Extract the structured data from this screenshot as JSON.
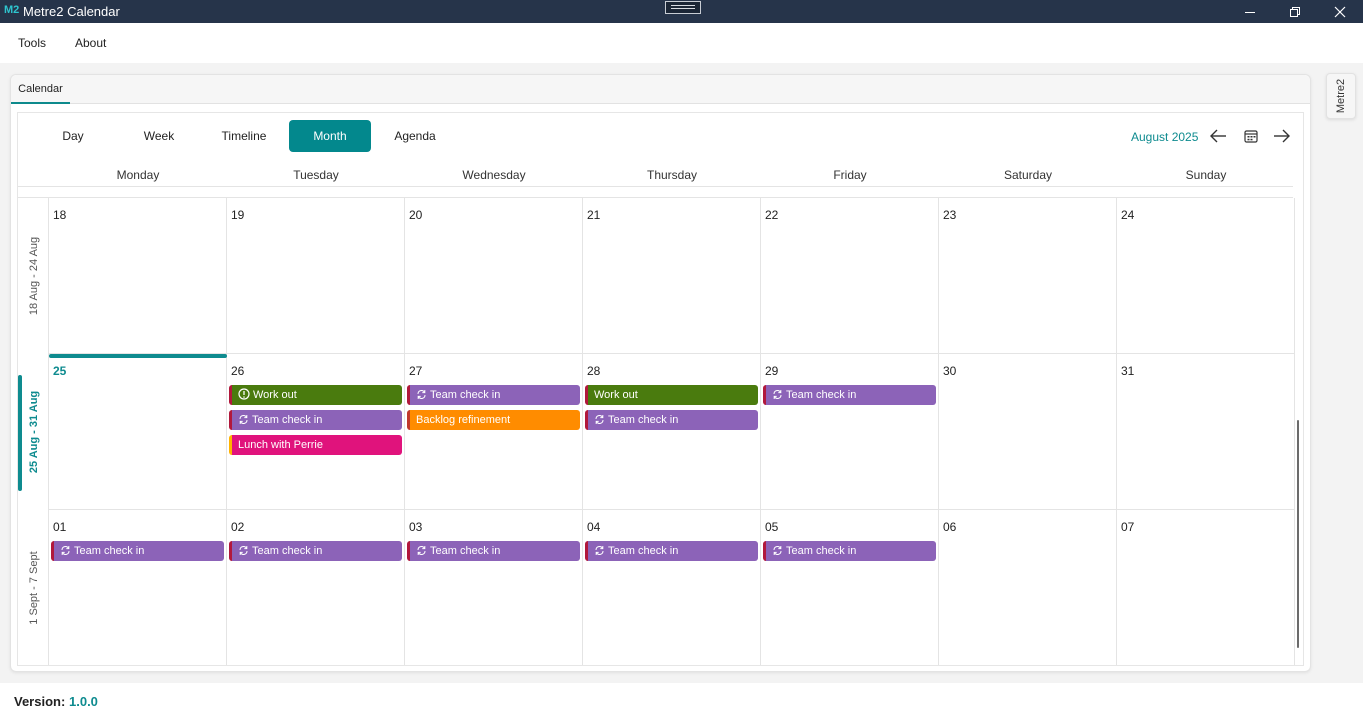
{
  "window": {
    "logo": "M2",
    "title": "Metre2 Calendar"
  },
  "menu": {
    "tools": "Tools",
    "about": "About"
  },
  "tabs": {
    "calendar": "Calendar",
    "side": "Metre2"
  },
  "views": {
    "day": "Day",
    "week": "Week",
    "timeline": "Timeline",
    "month": "Month",
    "agenda": "Agenda",
    "active": "Month"
  },
  "nav": {
    "current_month": "August 2025"
  },
  "day_names": [
    "Monday",
    "Tuesday",
    "Wednesday",
    "Thursday",
    "Friday",
    "Saturday",
    "Sunday"
  ],
  "weeks": [
    {
      "label": "18 Aug - 24 Aug",
      "days": [
        "18",
        "19",
        "20",
        "21",
        "22",
        "23",
        "24"
      ]
    },
    {
      "label": "25 Aug - 31 Aug",
      "days": [
        "25",
        "26",
        "27",
        "28",
        "29",
        "30",
        "31"
      ]
    },
    {
      "label": "1 Sept - 7 Sept",
      "days": [
        "01",
        "02",
        "03",
        "04",
        "05",
        "06",
        "07"
      ]
    }
  ],
  "events": {
    "w2_tue_1": "Work out",
    "w2_tue_2": "Team check in",
    "w2_tue_3": "Lunch with Perrie",
    "w2_wed_1": "Team check in",
    "w2_wed_2": "Backlog refinement",
    "w2_thu_1": "Work out",
    "w2_thu_2": "Team check in",
    "w2_fri_1": "Team check in",
    "w3_mon_1": "Team check in",
    "w3_tue_1": "Team check in",
    "w3_wed_1": "Team check in",
    "w3_thu_1": "Team check in",
    "w3_fri_1": "Team check in"
  },
  "colors": {
    "accent": "#03888d",
    "titlebar": "#26344a",
    "event_purple": "#8c63b8",
    "event_green": "#4a7b0e",
    "event_orange": "#ff8c00",
    "event_pink": "#e0137c"
  },
  "footer": {
    "version_label": "Version:",
    "version_value": "1.0.0"
  }
}
